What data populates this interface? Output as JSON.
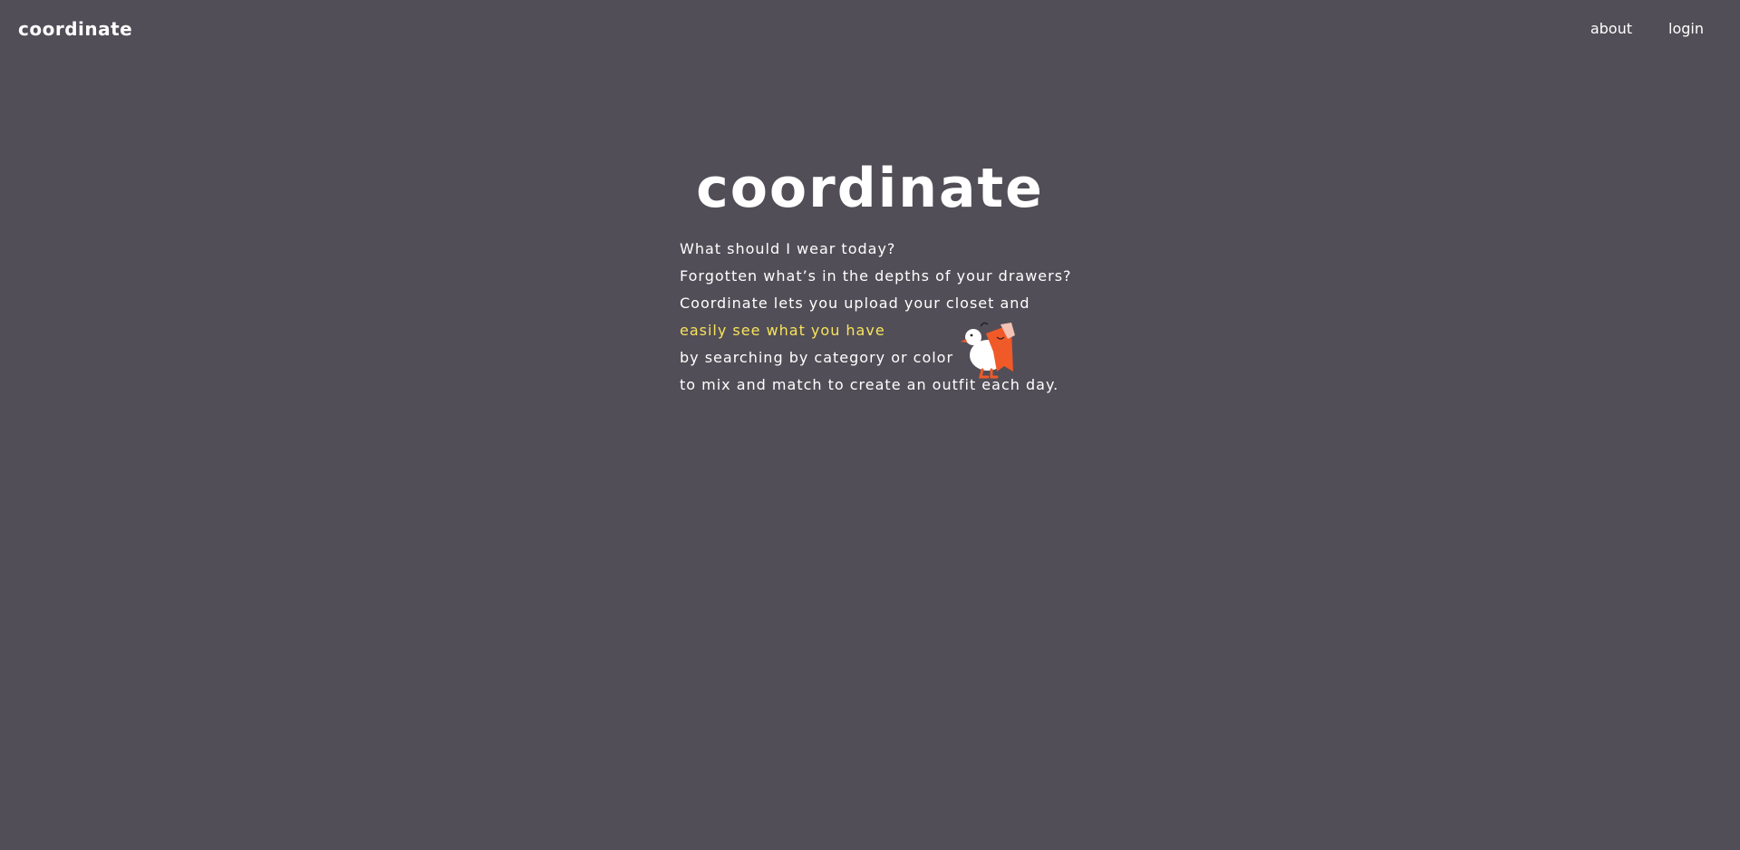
{
  "header": {
    "brand": "coordinate",
    "nav": [
      {
        "label": "about"
      },
      {
        "label": "login"
      }
    ]
  },
  "hero": {
    "title": "coordinate",
    "lines": [
      "What should I wear today?",
      "Forgotten what’s in the depths of your drawers?",
      "Coordinate lets you upload your closet and",
      "easily see what you have",
      "by searching by category or color",
      "to mix and match to create an outfit each day."
    ],
    "highlight_color": "#f7e35c"
  },
  "mascot": {
    "icon": "duck-mascot-icon"
  },
  "colors": {
    "background": "#524e57",
    "text": "#ffffff",
    "accent": "#f7e35c",
    "mascot_orange": "#f05a28"
  }
}
